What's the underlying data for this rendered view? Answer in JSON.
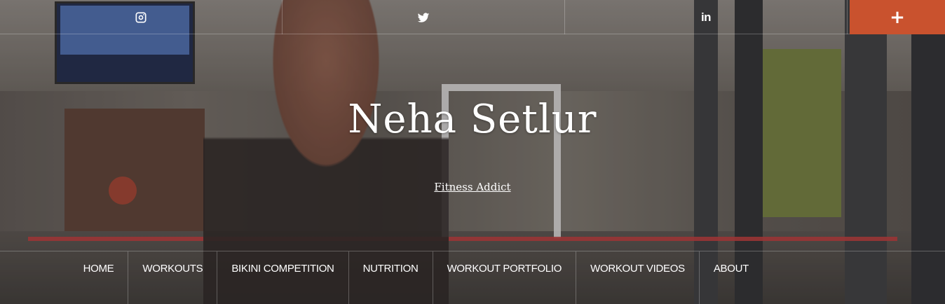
{
  "social": {
    "items": [
      {
        "icon": "instagram-icon"
      },
      {
        "icon": "twitter-icon"
      },
      {
        "icon": "linkedin-icon",
        "text": "in"
      }
    ],
    "more_label": "+",
    "more_color": "#c9522e"
  },
  "site": {
    "title": "Neha Setlur",
    "tagline": "Fitness Addict"
  },
  "nav": {
    "items": [
      {
        "label": "HOME"
      },
      {
        "label": "WORKOUTS"
      },
      {
        "label": "BIKINI COMPETITION"
      },
      {
        "label": "NUTRITION"
      },
      {
        "label": "WORKOUT PORTFOLIO"
      },
      {
        "label": "WORKOUT VIDEOS"
      },
      {
        "label": "ABOUT"
      }
    ]
  }
}
